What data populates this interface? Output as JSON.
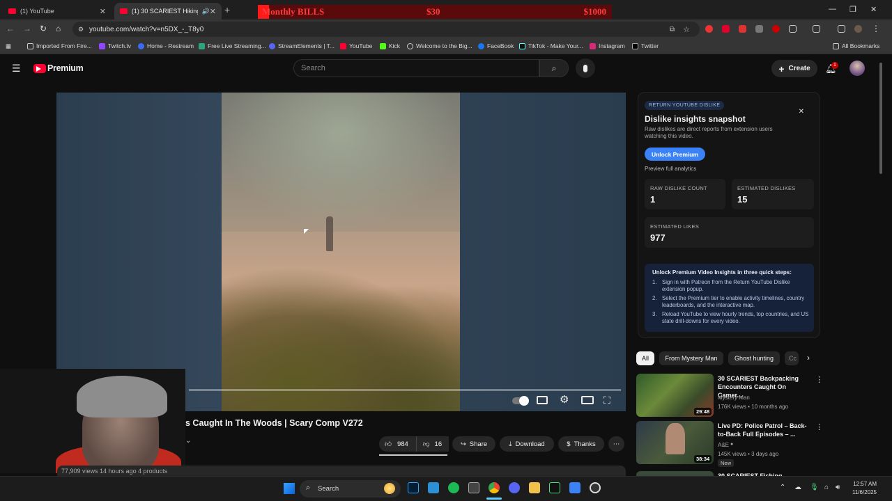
{
  "browser": {
    "tabs": [
      {
        "title": "(1) YouTube"
      },
      {
        "title": "(1) 30 SCARIEST Hiking Enc"
      }
    ],
    "url": "youtube.com/watch?v=n5DX_-_T8y0",
    "bookmarks": [
      "Imported From Fire...",
      "Twitch.tv",
      "Home - Restream",
      "Free Live Streaming...",
      "StreamElements | T...",
      "YouTube",
      "Kick",
      "Welcome to the Big...",
      "FaceBook",
      "TikTok - Make Your...",
      "Instagram",
      "Twitter"
    ],
    "all_bookmarks": "All Bookmarks"
  },
  "overlay": {
    "label": "Monthly BILLS",
    "amount1": "$30",
    "amount2": "$1000"
  },
  "youtube": {
    "logo_text": "Premium",
    "search_placeholder": "Search",
    "create_label": "Create",
    "notif_count": "1"
  },
  "video": {
    "title": "s Caught In The Woods | Scary Comp V272",
    "likes": "984",
    "dislikes": "16",
    "share": "Share",
    "download": "Download",
    "thanks": "Thanks",
    "meta": "77,909 views  14 hours ago  4 products"
  },
  "panel": {
    "badge": "RETURN YOUTUBE DISLIKE",
    "heading": "Dislike insights snapshot",
    "desc": "Raw dislikes are direct reports from extension users watching this video.",
    "unlock": "Unlock Premium",
    "preview": "Preview full analytics",
    "raw_label": "RAW DISLIKE COUNT",
    "raw_value": "1",
    "est_dis_label": "ESTIMATED DISLIKES",
    "est_dis_value": "15",
    "est_likes_label": "ESTIMATED LIKES",
    "est_likes_value": "977",
    "steps_title": "Unlock Premium Video Insights in three quick steps:",
    "steps": [
      "Sign in with Patreon from the Return YouTube Dislike extension popup.",
      "Select the Premium tier to enable activity timelines, country leaderboards, and the interactive map.",
      "Reload YouTube to view hourly trends, top countries, and US state drill-downs for every video."
    ]
  },
  "chips": [
    "All",
    "From Mystery Man",
    "Ghost hunting",
    "Cc"
  ],
  "recs": [
    {
      "title": "30 SCARIEST Backpacking Encounters Caught On Camer...",
      "channel": "Mystery Man",
      "views": "176K views • 10 months ago",
      "duration": "29:48"
    },
    {
      "title": "Live PD: Police Patrol – Back-to-Back Full Episodes – ...",
      "channel": "A&E",
      "views": "145K views • 3 days ago",
      "duration": "38:34",
      "badge": "New"
    },
    {
      "title": "30 SCARIEST Fishing",
      "channel": "",
      "views": "",
      "duration": ""
    }
  ],
  "taskbar": {
    "search": "Search",
    "time": "12:57 AM",
    "date": "11/6/2025"
  }
}
